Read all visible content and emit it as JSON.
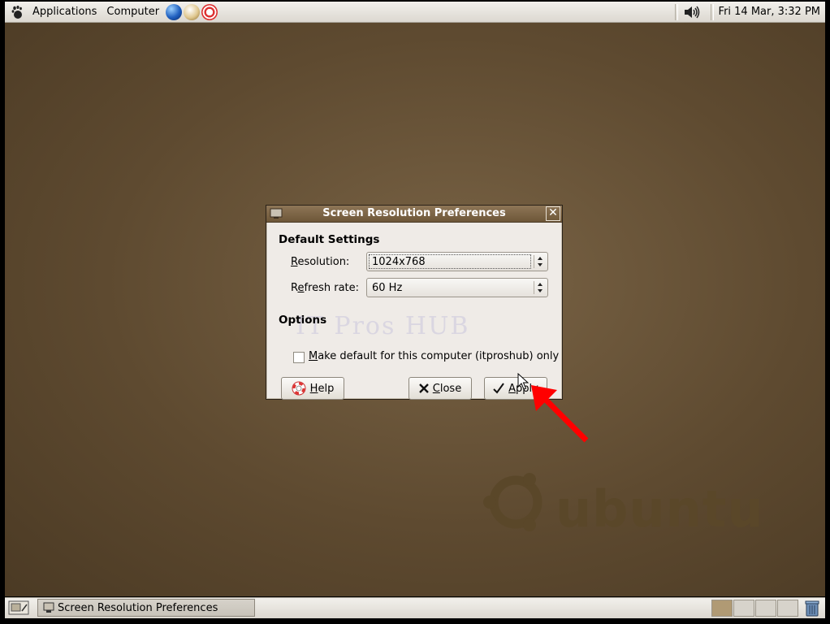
{
  "top_panel": {
    "menus": [
      {
        "label": "Applications"
      },
      {
        "label": "Computer"
      }
    ],
    "launchers": [
      "globe-icon",
      "mail-icon",
      "lifebuoy-icon"
    ],
    "clock": "Fri 14 Mar,  3:32 PM"
  },
  "desktop": {
    "brand": "ubuntu"
  },
  "dialog": {
    "title": "Screen Resolution Preferences",
    "section_default": "Default Settings",
    "resolution_label": "Resolution:",
    "resolution_value": "1024x768",
    "refresh_label": "Refresh rate:",
    "refresh_value": "60 Hz",
    "section_options": "Options",
    "checkbox_label": "Make default for this computer (itproshub) only",
    "checkbox_checked": false,
    "watermark": "IT Pros HUB",
    "buttons": {
      "help": "Help",
      "close": "Close",
      "apply": "Apply"
    }
  },
  "bottom_panel": {
    "task_label": "Screen Resolution Preferences",
    "workspaces": 4,
    "active_workspace": 1
  },
  "colors": {
    "desktop": "#5e4a30",
    "titlebar": "#7a6446",
    "annotation": "#ff0000"
  }
}
